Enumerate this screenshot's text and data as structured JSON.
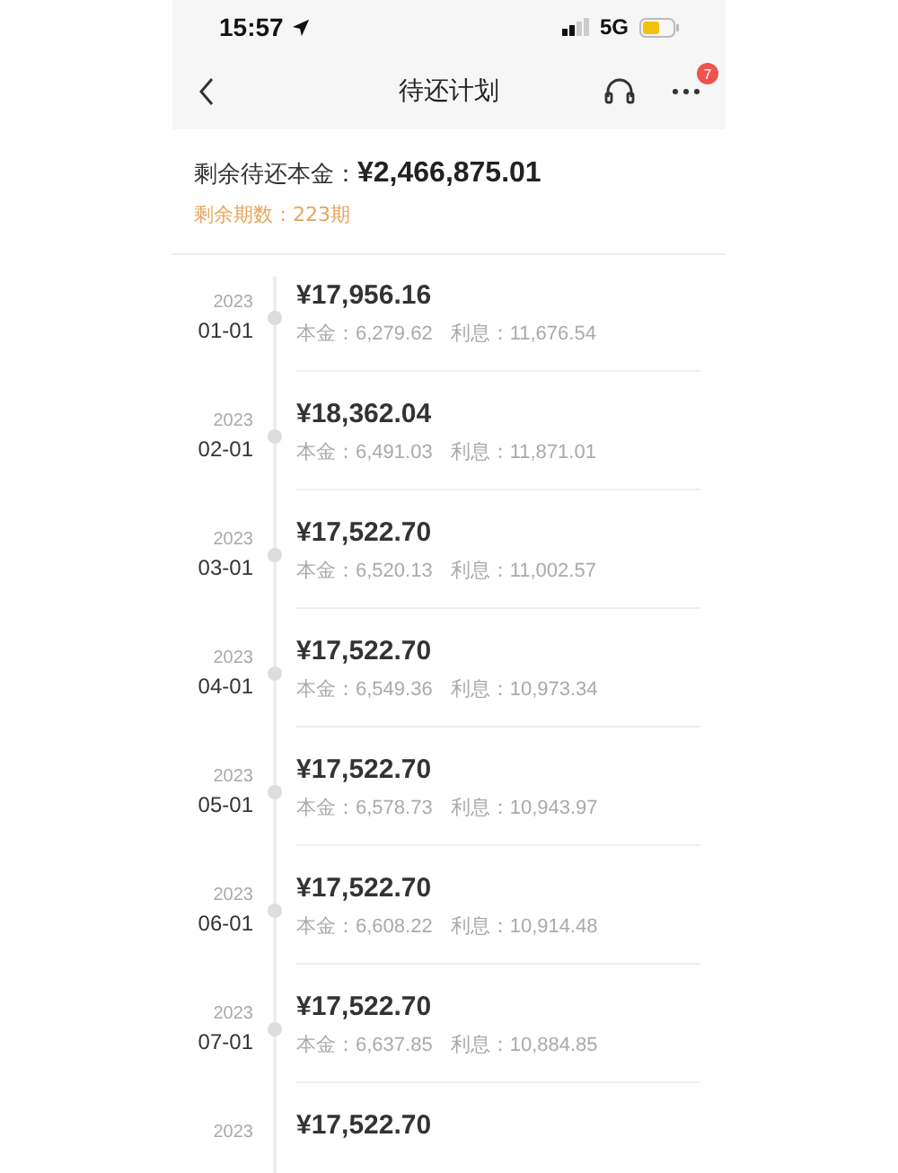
{
  "status_bar": {
    "time": "15:57",
    "network": "5G"
  },
  "nav": {
    "title": "待还计划",
    "badge": "7"
  },
  "summary": {
    "label": "剩余待还本金：",
    "amount": "¥2,466,875.01",
    "periods": "剩余期数：223期"
  },
  "schedule": [
    {
      "year": "2023",
      "date": "01-01",
      "amount": "¥17,956.16",
      "principal": "本金：6,279.62",
      "interest": "利息：11,676.54"
    },
    {
      "year": "2023",
      "date": "02-01",
      "amount": "¥18,362.04",
      "principal": "本金：6,491.03",
      "interest": "利息：11,871.01"
    },
    {
      "year": "2023",
      "date": "03-01",
      "amount": "¥17,522.70",
      "principal": "本金：6,520.13",
      "interest": "利息：11,002.57"
    },
    {
      "year": "2023",
      "date": "04-01",
      "amount": "¥17,522.70",
      "principal": "本金：6,549.36",
      "interest": "利息：10,973.34"
    },
    {
      "year": "2023",
      "date": "05-01",
      "amount": "¥17,522.70",
      "principal": "本金：6,578.73",
      "interest": "利息：10,943.97"
    },
    {
      "year": "2023",
      "date": "06-01",
      "amount": "¥17,522.70",
      "principal": "本金：6,608.22",
      "interest": "利息：10,914.48"
    },
    {
      "year": "2023",
      "date": "07-01",
      "amount": "¥17,522.70",
      "principal": "本金：6,637.85",
      "interest": "利息：10,884.85"
    },
    {
      "year": "2023",
      "amount": "¥17,522.70"
    }
  ]
}
